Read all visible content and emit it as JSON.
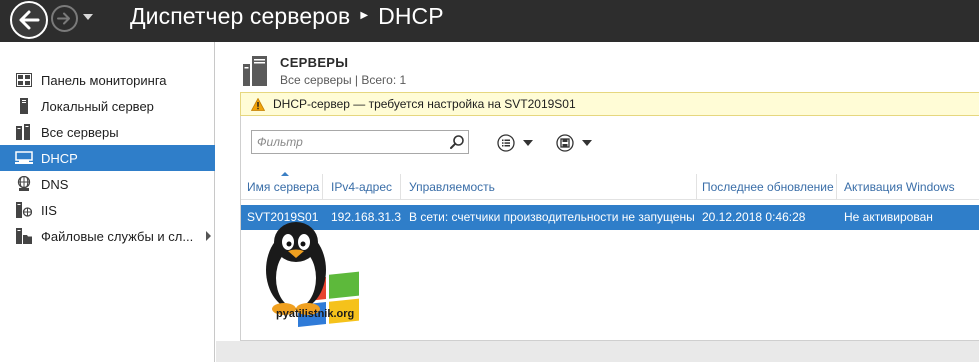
{
  "window": {
    "title": "Диспетчер серверов",
    "breadcrumb_current": "DHCP"
  },
  "nav": {
    "back_icon": "back-arrow-icon",
    "forward_icon": "forward-arrow-icon"
  },
  "sidebar": {
    "items": [
      {
        "label": "Панель мониторинга",
        "icon": "dashboard-icon"
      },
      {
        "label": "Локальный сервер",
        "icon": "server-icon"
      },
      {
        "label": "Все серверы",
        "icon": "servers-icon"
      },
      {
        "label": "DHCP",
        "icon": "dhcp-icon",
        "active": true
      },
      {
        "label": "DNS",
        "icon": "dns-icon"
      },
      {
        "label": "IIS",
        "icon": "iis-icon"
      },
      {
        "label": "Файловые службы и сл...",
        "icon": "file-services-icon"
      }
    ]
  },
  "servers": {
    "title": "СЕРВЕРЫ",
    "subtitle": "Все серверы | Всего: 1"
  },
  "warning": {
    "text": "DHCP-сервер — требуется настройка на SVT2019S01",
    "icon": "warning-icon"
  },
  "toolbar": {
    "filter_placeholder": "Фильтр"
  },
  "table": {
    "columns": [
      "Имя сервера",
      "IPv4-адрес",
      "Управляемость",
      "Последнее обновление",
      "Активация Windows"
    ],
    "rows": [
      [
        "SVT2019S01",
        "192.168.31.3",
        "В сети: счетчики производительности не запущены",
        "20.12.2018 0:46:28",
        "Не активирован"
      ]
    ]
  },
  "watermark": {
    "text": "pyatilistnik.org"
  },
  "colors": {
    "titlebar": "#2d2d2d",
    "accent": "#2f7ec9",
    "warning_bg": "#fffcd6",
    "header_text": "#3a6ea8"
  }
}
